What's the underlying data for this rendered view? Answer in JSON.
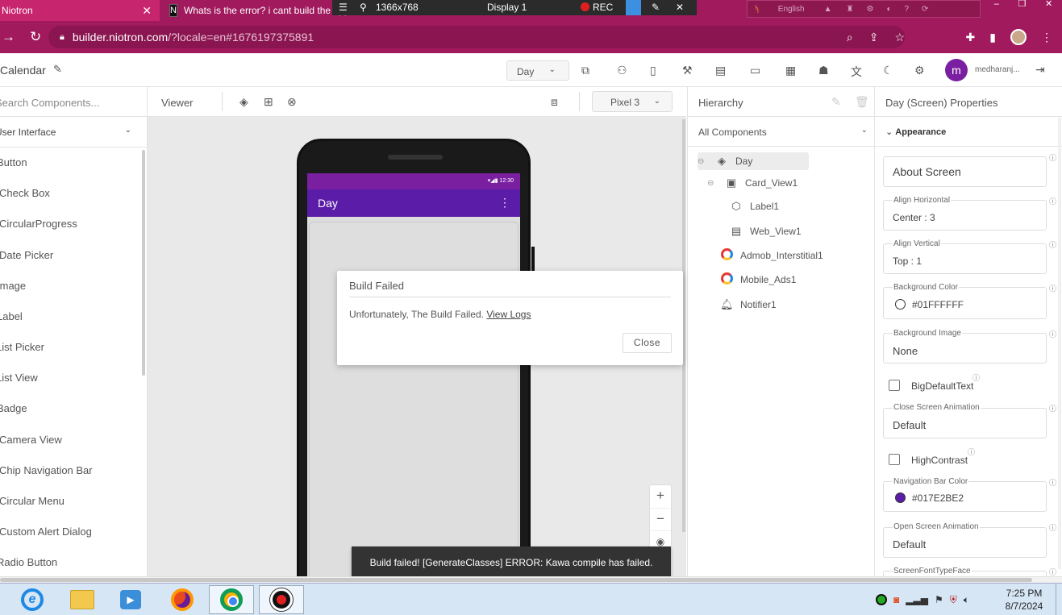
{
  "browser": {
    "tab1_title": "Niotron",
    "tab2_title": "Whats is the error? i cant build the app",
    "recorder": {
      "resolution": "1366x768",
      "display": "Display 1",
      "rec": "REC"
    },
    "language": "English",
    "url_host": "builder.niotron.com",
    "url_path": "/?locale=en#1676197375891"
  },
  "app": {
    "project_name": "Calendar",
    "screen_selected": "Day",
    "user_initial": "m",
    "user_name": "medharanj..."
  },
  "palette": {
    "search_placeholder": "Search Components...",
    "category": "User Interface",
    "items": [
      "Button",
      "Check Box",
      "CircularProgress",
      "Date Picker",
      "Image",
      "Label",
      "List Picker",
      "List View",
      "Badge",
      "Camera View",
      "Chip Navigation Bar",
      "Circular Menu",
      "Custom Alert Dialog",
      "Radio Button"
    ]
  },
  "viewer": {
    "title": "Viewer",
    "device": "Pixel 3",
    "phone_time": "12:30",
    "app_title": "Day",
    "zoom_in": "+",
    "zoom_out": "−",
    "toast": "Build failed! [GenerateClasses] ERROR: Kawa compile has failed."
  },
  "hierarchy": {
    "title": "Hierarchy",
    "filter": "All Components",
    "items": [
      {
        "label": "Day",
        "icon": "layers-icon"
      },
      {
        "label": "Card_View1",
        "icon": "card-icon"
      },
      {
        "label": "Label1",
        "icon": "label-icon"
      },
      {
        "label": "Web_View1",
        "icon": "webview-icon"
      },
      {
        "label": "Admob_Interstitial1",
        "icon": "admob-icon"
      },
      {
        "label": "Mobile_Ads1",
        "icon": "admob-icon"
      },
      {
        "label": "Notifier1",
        "icon": "bell-icon"
      }
    ]
  },
  "properties": {
    "title": "Day (Screen) Properties",
    "section": "Appearance",
    "about_screen": "About Screen",
    "align_horizontal": {
      "label": "Align Horizontal",
      "value": "Center : 3"
    },
    "align_vertical": {
      "label": "Align Vertical",
      "value": "Top : 1"
    },
    "background_color": {
      "label": "Background Color",
      "value": "#01FFFFFF",
      "swatch": "#ffffff"
    },
    "background_image": {
      "label": "Background Image",
      "value": "None"
    },
    "big_default_text": "BigDefaultText",
    "close_screen_animation": {
      "label": "Close Screen Animation",
      "value": "Default"
    },
    "high_contrast": "HighContrast",
    "navigation_bar_color": {
      "label": "Navigation Bar Color",
      "value": "#017E2BE2",
      "swatch": "#5b1ca8"
    },
    "open_screen_animation": {
      "label": "Open Screen Animation",
      "value": "Default"
    },
    "screen_font": {
      "label": "ScreenFontTypeFace"
    }
  },
  "dialog": {
    "title": "Build Failed",
    "message": "Unfortunately, The Build Failed. ",
    "link": "View Logs",
    "close": "Close"
  },
  "taskbar": {
    "time": "7:25 PM",
    "date": "8/7/2024"
  },
  "colors": {
    "brand": "#a11a5e",
    "app_purple": "#5b1ca8",
    "avatar": "#7b1fa2"
  }
}
